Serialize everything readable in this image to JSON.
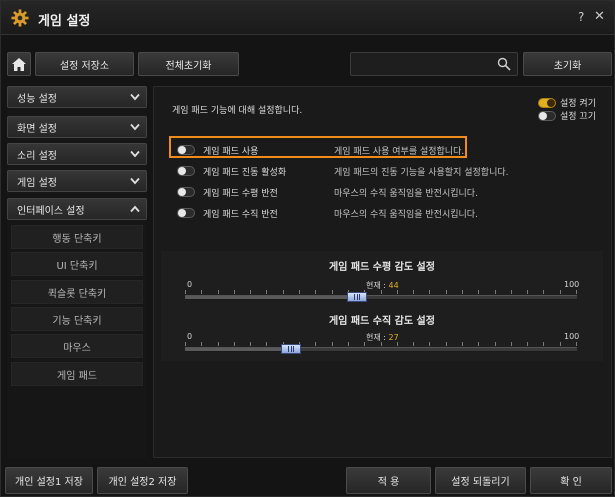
{
  "window": {
    "title": "게임 설정",
    "help": "?",
    "close": "✕"
  },
  "toolbar": {
    "save_store": "설정 저장소",
    "reset_all": "전체초기화",
    "reset": "초기화",
    "search_placeholder": ""
  },
  "sidebar": {
    "menu": [
      {
        "label": "성능 설정",
        "expanded": false
      },
      {
        "label": "화면 설정",
        "expanded": false
      },
      {
        "label": "소리 설정",
        "expanded": false
      },
      {
        "label": "게임 설정",
        "expanded": false
      },
      {
        "label": "인터페이스 설정",
        "expanded": true
      }
    ],
    "submenu": [
      "행동 단축키",
      "UI 단축키",
      "퀵슬롯 단축키",
      "기능 단축키",
      "마우스",
      "게임 패드"
    ]
  },
  "content": {
    "header": "게임 패드 기능에 대해 설정합니다.",
    "legend": {
      "on": "설정 켜기",
      "off": "설정 끄기"
    },
    "options": [
      {
        "label": "게임 패드 사용",
        "desc": "게임 패드 사용 여부를 설정합니다.",
        "on": false
      },
      {
        "label": "게임 패드 진동 활성화",
        "desc": "게임 패드의 진동 기능을 사용할지 설정합니다.",
        "on": false
      },
      {
        "label": "게임 패드 수평 반전",
        "desc": "마우스의 수직 움직임을 반전시킵니다.",
        "on": false
      },
      {
        "label": "게임 패드 수직 반전",
        "desc": "마우스의 수직 움직임을 반전시킵니다.",
        "on": false
      }
    ],
    "sliders": [
      {
        "title": "게임 패드 수평 감도 설정",
        "min": "0",
        "max": "100",
        "current_label": "현재 : ",
        "value": 44
      },
      {
        "title": "게임 패드 수직 감도 설정",
        "min": "0",
        "max": "100",
        "current_label": "현재 : ",
        "value": 27
      }
    ]
  },
  "footer": {
    "personal1": "개인 설정1 저장",
    "personal2": "개인 설정2 저장",
    "apply": "적 용",
    "revert": "설정 되돌리기",
    "confirm": "확 인"
  },
  "colors": {
    "accent": "#e0b020",
    "highlight": "#f08c1a"
  }
}
